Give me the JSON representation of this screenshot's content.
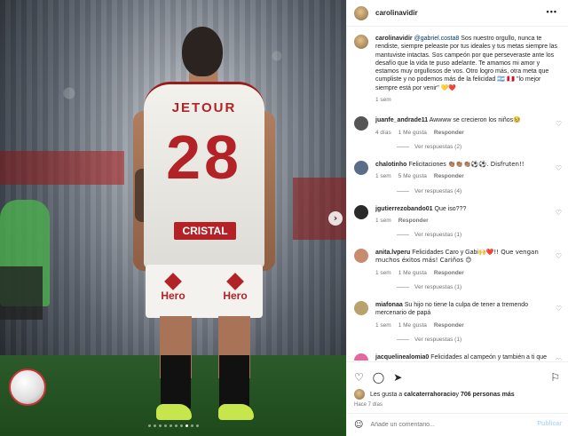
{
  "post": {
    "username": "carolinavidir",
    "more": "•••"
  },
  "caption": {
    "username": "carolinavidir",
    "mention": "@gabriel.costa8",
    "text": " Sos nuestro orgullo, nunca te rendiste, siempre peleaste por tus ideales y tus metas siempre las mantuviste intactas. Sos campeón por que perseveraste ante los desafío que la vida te puso adelante. Te amamos mi amor y estamos muy orgullosos de vos. Otro logro más, otra meta que cumpliste y no podemos más de la felicidad ",
    "emoji_flags": "🇦🇷 🇵🇪",
    "quote": "\"lo mejor siempre está por venir\"",
    "emoji_end": "💛❤️",
    "time": "1 sem"
  },
  "comments": [
    {
      "username": "juanfe_andrade11",
      "text": "Awwww se crecieron los niños",
      "emoji": "🥹",
      "time": "4 días",
      "likes": "1 Me gusta",
      "reply": "Responder",
      "replies": "Ver respuestas (2)",
      "avatar_color": "#555"
    },
    {
      "username": "chalotinho",
      "text": "Felicitaciones ",
      "emoji": "👏🏽👏🏽👏🏽⚽⚽. Disfruten!!",
      "time": "1 sem",
      "likes": "5 Me gusta",
      "reply": "Responder",
      "replies": "Ver respuestas (4)",
      "avatar_color": "#5a6e88"
    },
    {
      "username": "jgutierrezobando01",
      "text": "Que iso???",
      "emoji": "",
      "time": "1 sem",
      "likes": "",
      "reply": "Responder",
      "replies": "Ver respuestas (1)",
      "avatar_color": "#2a2a2a"
    },
    {
      "username": "anita.lvperu",
      "text": "Felicidades Caro y Gabi",
      "emoji": "🙌❤️!! Que vengan muchos éxitos más! Cariños 😊",
      "time": "1 sem",
      "likes": "1 Me gusta",
      "reply": "Responder",
      "replies": "Ver respuestas (1)",
      "avatar_color": "#c98b6e"
    },
    {
      "username": "miafonaa",
      "text": "Su hijo no tiene la culpa de tener a tremendo mercenario de papá",
      "emoji": "",
      "time": "1 sem",
      "likes": "1 Me gusta",
      "reply": "Responder",
      "replies": "Ver respuestas (1)",
      "avatar_color": "#b7a36b"
    },
    {
      "username": "jacquelinealomia0",
      "text": "Felicidades al campeón y también a ti que",
      "emoji": "",
      "time": "",
      "likes": "",
      "reply": "",
      "replies": "",
      "avatar_color": "#e06aa0"
    }
  ],
  "actions": {
    "likes_prefix": "Les gusta a ",
    "likes_user": "calcaterrahoracio",
    "likes_mid": " y ",
    "likes_count": "706 personas más",
    "ago": "Hace 7 días"
  },
  "compose": {
    "placeholder": "Añade un comentario...",
    "post": "Publicar"
  },
  "media": {
    "sponsor": "JETOUR",
    "number": "28",
    "chest": "CRISTAL",
    "shorts_sponsor": "Hero",
    "carousel_index": 8,
    "carousel_count": 10
  },
  "colors": {
    "accent": "#b32226",
    "mention": "#00376b",
    "muted": "#737373",
    "post_button": "#b3dbff"
  }
}
